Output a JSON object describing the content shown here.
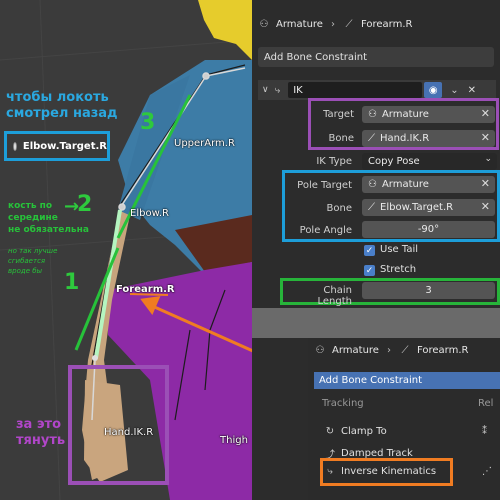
{
  "viewport": {
    "annotations": {
      "elbow_note_line1": "чтобы локоть",
      "elbow_note_line2": "смотрел назад",
      "middle_note_line1": "кость по",
      "middle_note_line2": "середине",
      "middle_note_line3": "не обязательна",
      "bend_note_line1": "но так лучше",
      "bend_note_line2": "сгибается",
      "bend_note_line3": "вроде бы",
      "pull_note_line1": "за это",
      "pull_note_line2": "тянуть",
      "num1": "1",
      "num2": "2",
      "num3": "3",
      "num2_arrow": "→"
    },
    "bones": {
      "elbow_target": "Elbow.Target.R",
      "upperarm": "UpperArm.R",
      "elbow": "Elbow.R",
      "forearm": "Forearm.R",
      "hand_ik": "Hand.IK.R",
      "thigh": "Thigh"
    },
    "colors": {
      "skin": "#c9a57e",
      "shirt": "#3c7aa3",
      "pants": "#8e2aa8",
      "hair": "#e8cf2a",
      "green": "#2ec93d",
      "blue": "#1d9ed9",
      "orange": "#f07c22",
      "purple": "#9b4fb6"
    }
  },
  "panel": {
    "breadcrumb": {
      "object": "Armature",
      "bone": "Forearm.R"
    },
    "add_bone_constraint": "Add Bone Constraint",
    "constraint": {
      "name": "IK",
      "target_label": "Target",
      "target_value": "Armature",
      "bone_label": "Bone",
      "bone_value": "Hand.IK.R",
      "ik_type_label": "IK Type",
      "ik_type_value": "Copy Pose",
      "pole_target_label": "Pole Target",
      "pole_target_value": "Armature",
      "pole_bone_label": "Bone",
      "pole_bone_value": "Elbow.Target.R",
      "pole_angle_label": "Pole Angle",
      "pole_angle_value": "-90°",
      "use_tail_label": "Use Tail",
      "use_tail_checked": true,
      "stretch_label": "Stretch",
      "stretch_checked": true,
      "chain_length_label": "Chain Length",
      "chain_length_value": "3"
    },
    "inset": {
      "breadcrumb": {
        "object": "Armature",
        "bone": "Forearm.R"
      },
      "menu_title": "Add Bone Constraint",
      "category": "Tracking",
      "category_right": "Rel",
      "items": [
        "Clamp To",
        "Damped Track",
        "Inverse Kinematics"
      ]
    }
  }
}
